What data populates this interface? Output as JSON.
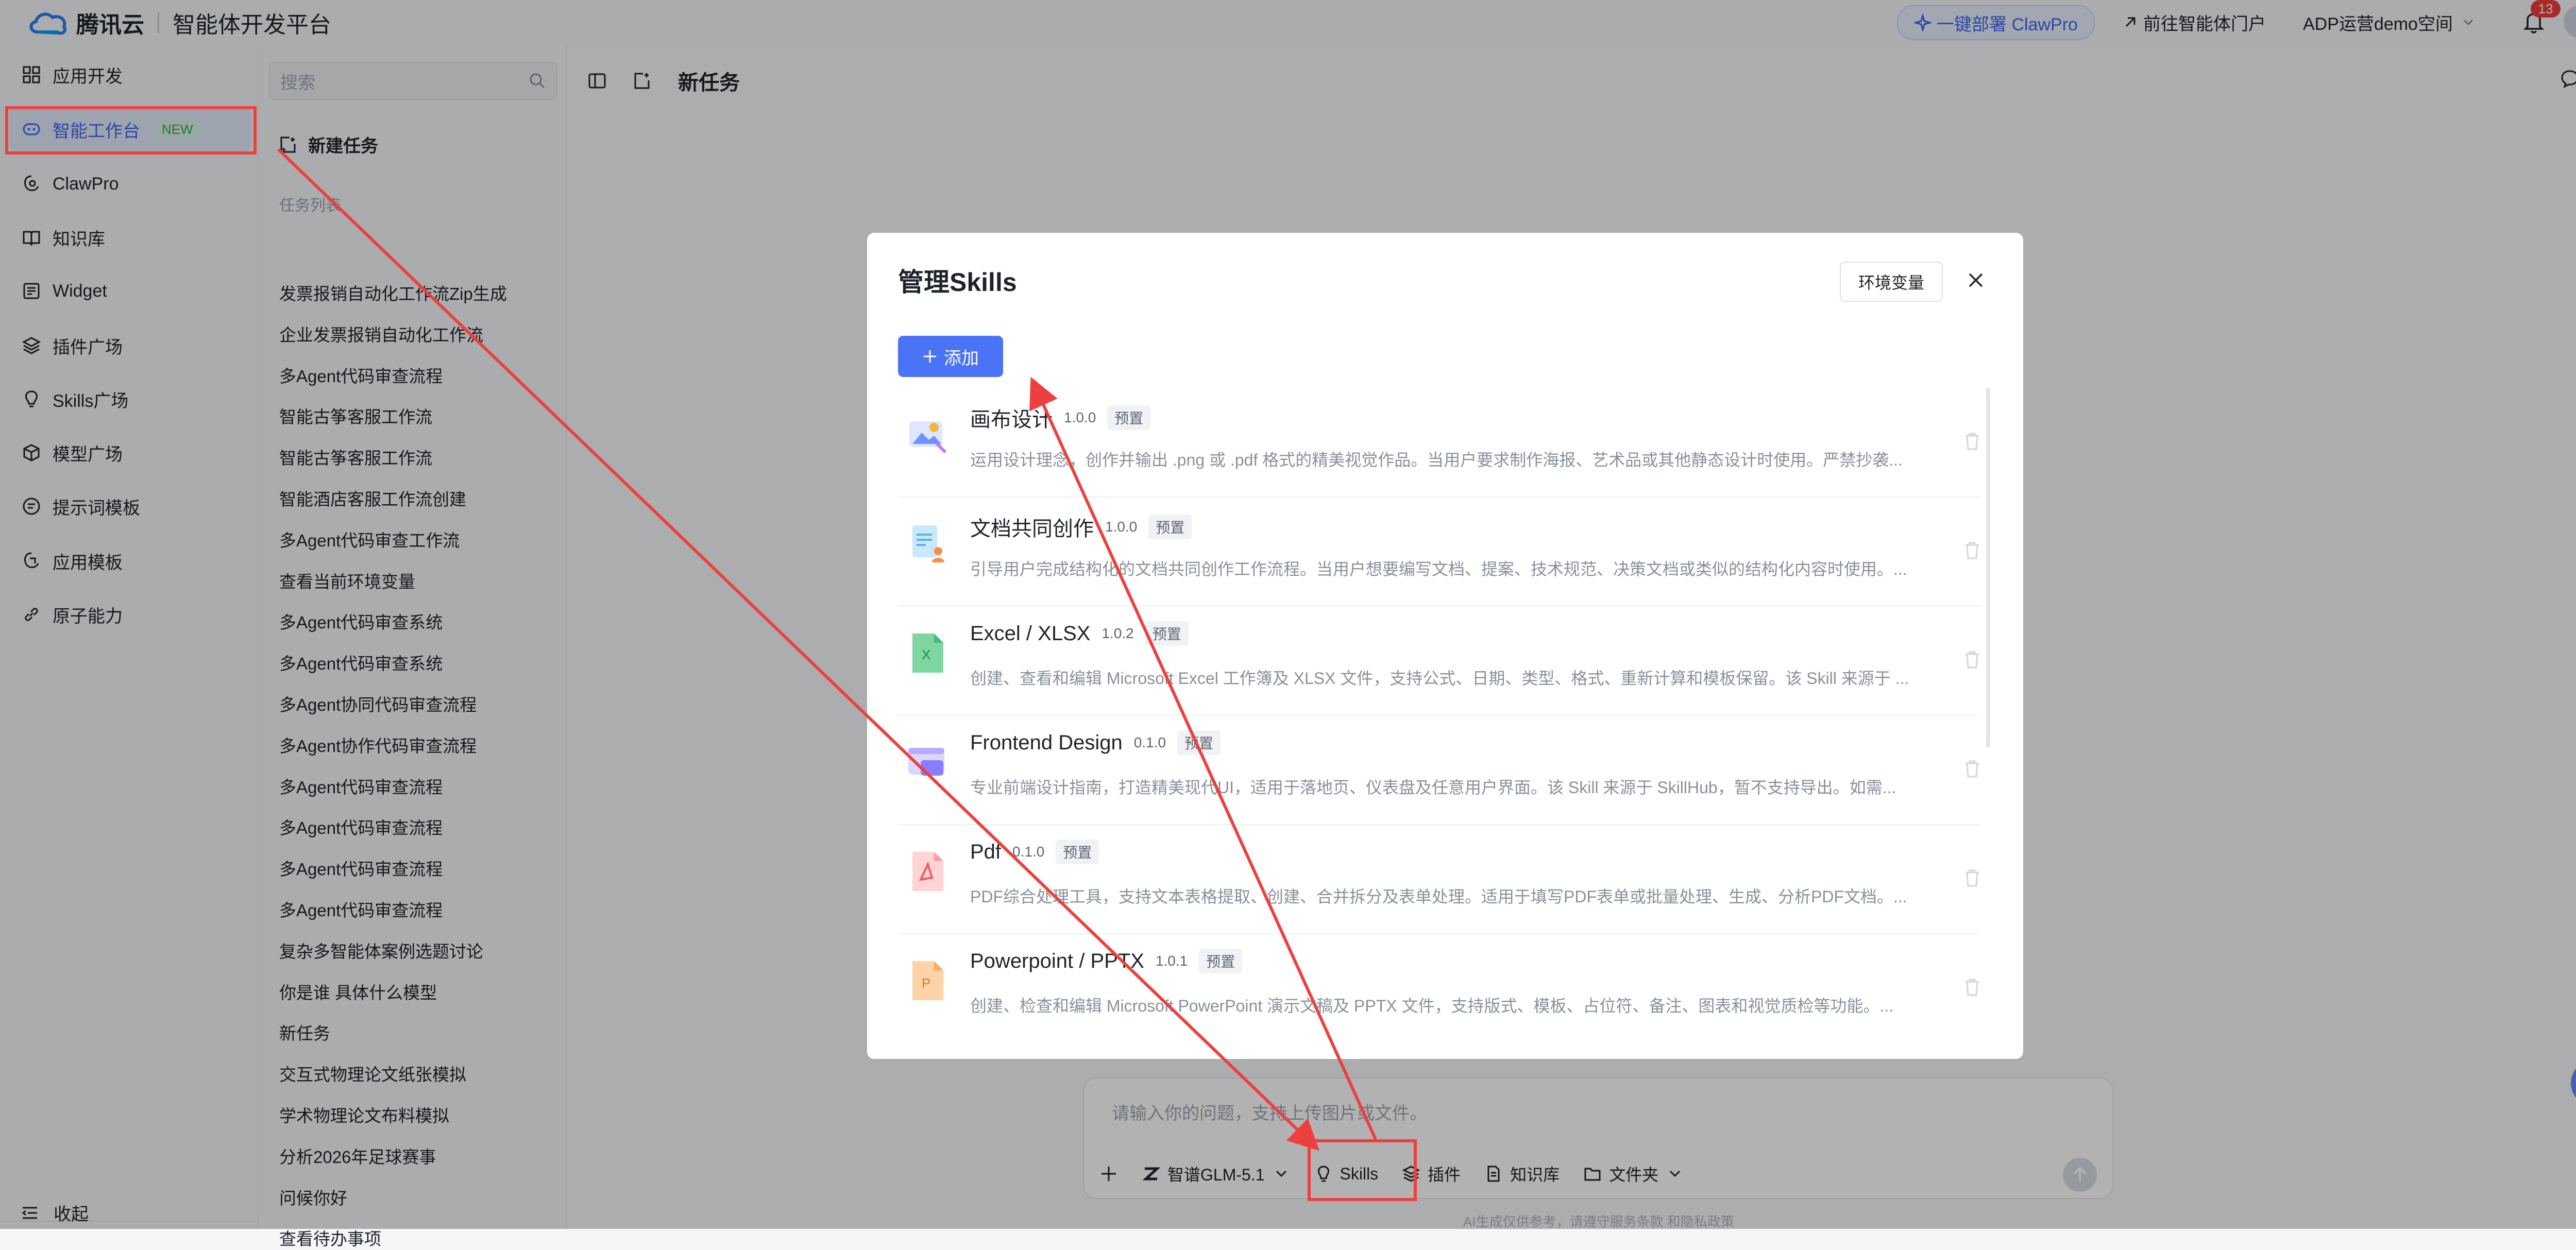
{
  "header": {
    "brand": "腾讯云",
    "product": "智能体开发平台",
    "deploy_label": "一键部署 ClawPro",
    "portal_label": "前往智能体门户",
    "space_label": "ADP运营demo空间",
    "notification_count": "13"
  },
  "sidebar": {
    "items": [
      {
        "label": "应用开发",
        "icon": "grid-icon"
      },
      {
        "label": "智能工作台",
        "icon": "workspace-icon",
        "badge": "NEW"
      },
      {
        "label": "ClawPro",
        "icon": "clawpro-icon"
      },
      {
        "label": "知识库",
        "icon": "book-icon"
      },
      {
        "label": "Widget",
        "icon": "widget-icon"
      },
      {
        "label": "插件广场",
        "icon": "layers-icon"
      },
      {
        "label": "Skills广场",
        "icon": "bulb-icon"
      },
      {
        "label": "模型广场",
        "icon": "cube-icon"
      },
      {
        "label": "提示词模板",
        "icon": "prompt-icon"
      },
      {
        "label": "应用模板",
        "icon": "template-icon"
      },
      {
        "label": "原子能力",
        "icon": "link-icon"
      }
    ],
    "collapse_label": "收起"
  },
  "tasks": {
    "search_placeholder": "搜索",
    "new_task_label": "新建任务",
    "list_title": "任务列表",
    "items": [
      "发票报销自动化工作流Zip生成",
      "企业发票报销自动化工作流",
      "多Agent代码审查流程",
      "智能古筝客服工作流",
      "智能古筝客服工作流",
      "智能酒店客服工作流创建",
      "多Agent代码审查工作流",
      "查看当前环境变量",
      "多Agent代码审查系统",
      "多Agent代码审查系统",
      "多Agent协同代码审查流程",
      "多Agent协作代码审查流程",
      "多Agent代码审查流程",
      "多Agent代码审查流程",
      "多Agent代码审查流程",
      "多Agent代码审查流程",
      "复杂多智能体案例选题讨论",
      "你是谁 具体什么模型",
      "新任务",
      "交互式物理论文纸张模拟",
      "学术物理论文布料模拟",
      "分析2026年足球赛事",
      "问候你好",
      "查看待办事项"
    ]
  },
  "main": {
    "title": "新任务",
    "composer_placeholder": "请输入你的问题，支持上传图片或文件。",
    "model_label": "智谱GLM-5.1",
    "skills_label": "Skills",
    "plugins_label": "插件",
    "knowledge_label": "知识库",
    "folder_label": "文件夹",
    "disclaimer": "AI生成仅供参考，请遵守服务条款 和隐私政策"
  },
  "modal": {
    "title": "管理Skills",
    "env_button": "环境变量",
    "add_button": "添加",
    "skills": [
      {
        "name": "画布设计",
        "version": "1.0.0",
        "tag": "预置",
        "desc": "运用设计理念，创作并输出 .png 或 .pdf 格式的精美视觉作品。当用户要求制作海报、艺术品或其他静态设计时使用。严禁抄袭...",
        "icon": "canvas-image-icon"
      },
      {
        "name": "文档共同创作",
        "version": "1.0.0",
        "tag": "预置",
        "desc": "引导用户完成结构化的文档共同创作工作流程。当用户想要编写文档、提案、技术规范、决策文档或类似的结构化内容时使用。...",
        "icon": "doc-person-icon"
      },
      {
        "name": "Excel / XLSX",
        "version": "1.0.2",
        "tag": "预置",
        "desc": "创建、查看和编辑 Microsoft Excel 工作簿及 XLSX 文件，支持公式、日期、类型、格式、重新计算和模板保留。该 Skill 来源于 ...",
        "icon": "excel-icon"
      },
      {
        "name": "Frontend Design",
        "version": "0.1.0",
        "tag": "预置",
        "desc": "专业前端设计指南，打造精美现代UI，适用于落地页、仪表盘及任意用户界面。该 Skill 来源于 SkillHub，暂不支持导出。如需...",
        "icon": "browser-window-icon"
      },
      {
        "name": "Pdf",
        "version": "0.1.0",
        "tag": "预置",
        "desc": "PDF综合处理工具，支持文本表格提取、创建、合并拆分及表单处理。适用于填写PDF表单或批量处理、生成、分析PDF文档。...",
        "icon": "pdf-icon"
      },
      {
        "name": "Powerpoint / PPTX",
        "version": "1.0.1",
        "tag": "预置",
        "desc": "创建、检查和编辑 Microsoft PowerPoint 演示文稿及 PPTX 文件，支持版式、模板、占位符、备注、图表和视觉质检等功能。...",
        "icon": "pptx-icon"
      }
    ]
  },
  "colors": {
    "accent": "#4a73f5",
    "annotation_red": "#ee3f3f",
    "active_nav_bg": "#e3eafc",
    "new_badge": "#2fa965"
  }
}
